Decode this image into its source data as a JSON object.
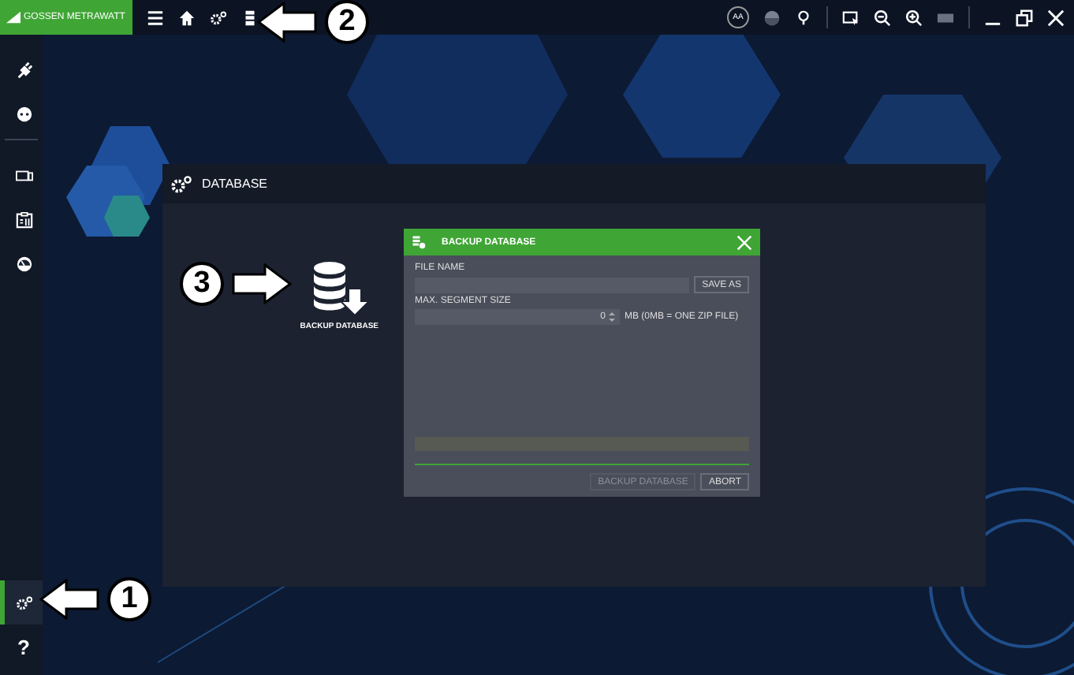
{
  "topbar": {
    "logo": "GOSSEN METRAWATT",
    "font_size_badge": "AA"
  },
  "sidebar": {
    "sections": [
      {
        "items": [
          {
            "kind": "plug",
            "selected": false
          },
          {
            "kind": "socket",
            "selected": false
          }
        ]
      },
      {
        "items": [
          {
            "kind": "monitor",
            "selected": false
          },
          {
            "kind": "clipboard",
            "selected": false
          },
          {
            "kind": "gauge",
            "selected": false
          }
        ]
      }
    ],
    "bottom_items": [
      {
        "kind": "settings",
        "selected": true
      },
      {
        "kind": "help",
        "label": "?",
        "selected": false
      }
    ]
  },
  "panel": {
    "title": "DATABASE",
    "tiles": [
      {
        "label": "BACKUP DATABASE"
      }
    ]
  },
  "dialog": {
    "title": "BACKUP DATABASE",
    "file_name_label": "FILE NAME",
    "save_as_button": "SAVE AS",
    "segment_label": "MAX. SEGMENT SIZE",
    "segment_value": "0",
    "segment_unit": "MB (0MB = ONE ZIP FILE)",
    "progress": {
      "level": 0
    },
    "buttons": [
      {
        "label": "BACKUP DATABASE",
        "disabled": true
      },
      {
        "label": "ABORT",
        "disabled": false
      }
    ]
  },
  "callouts": [
    {
      "number": "1"
    },
    {
      "number": "2"
    },
    {
      "number": "3"
    }
  ]
}
